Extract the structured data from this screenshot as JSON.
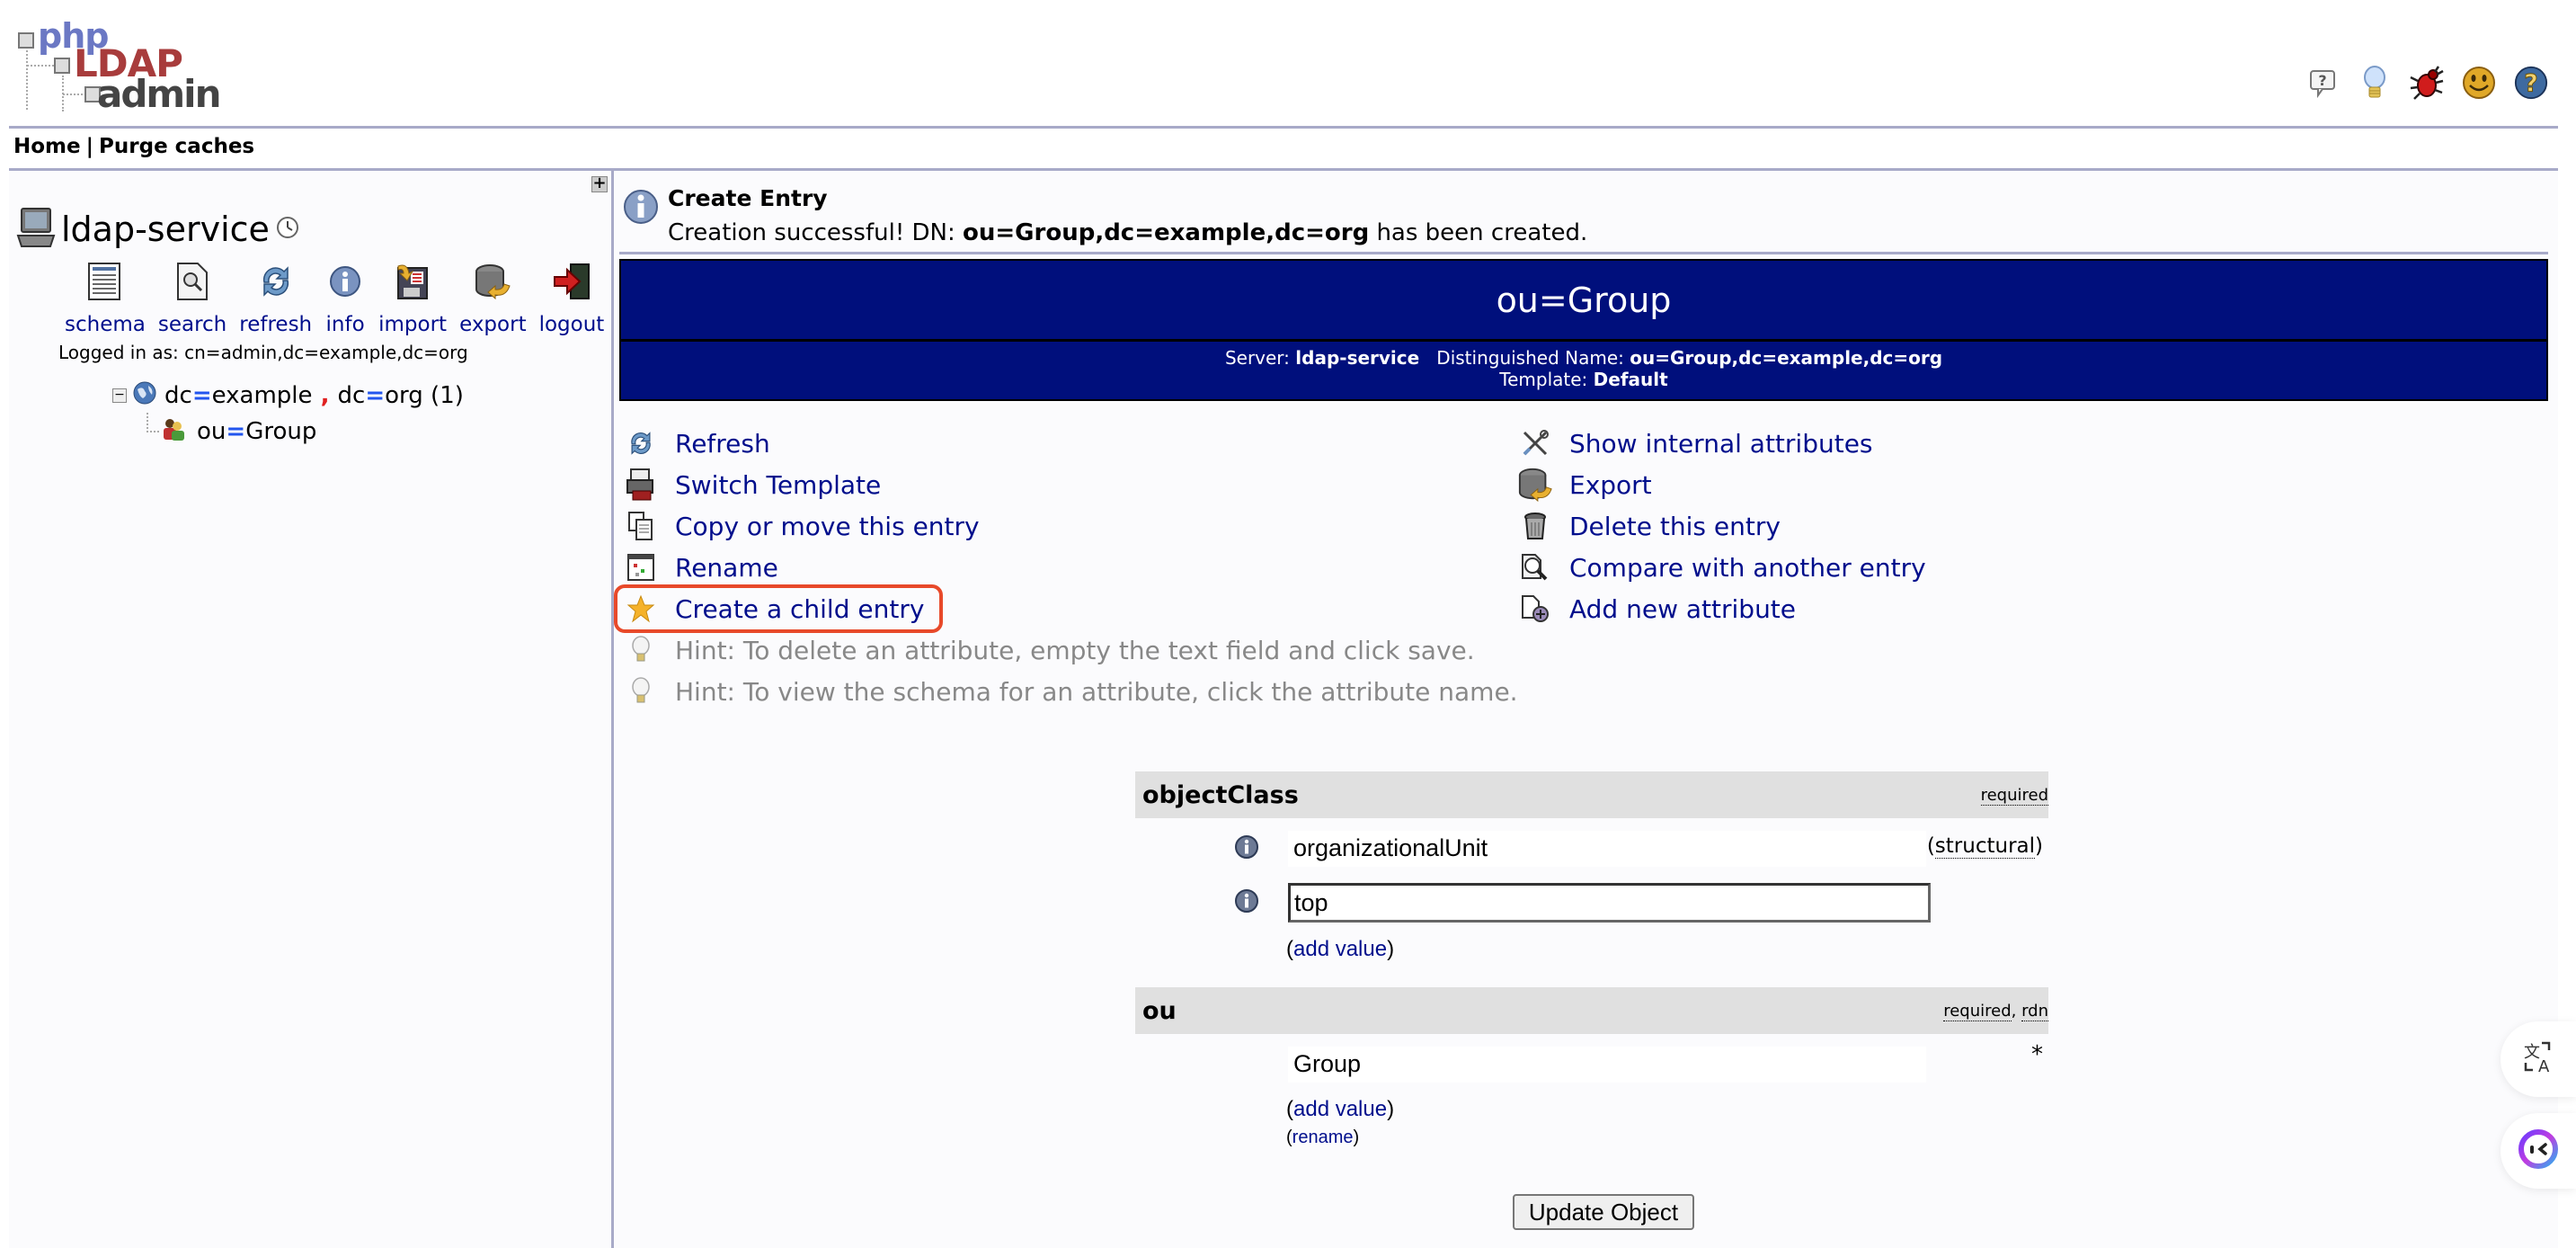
{
  "app": {
    "logo": {
      "php": "php",
      "ldap": "LDAP",
      "admin": "admin"
    },
    "top_icons": [
      {
        "name": "help-bubble-icon",
        "title": "Help"
      },
      {
        "name": "lightbulb-icon",
        "title": "Suggestion"
      },
      {
        "name": "bug-icon",
        "title": "Report a bug"
      },
      {
        "name": "smiley-icon",
        "title": "Donate"
      },
      {
        "name": "help-globe-icon",
        "title": "Help"
      }
    ],
    "colors": {
      "link": "#000e8c",
      "banner": "#000f7c",
      "divider": "#a8aac8",
      "highlight": "#e8492a"
    }
  },
  "nav": {
    "home": "Home",
    "separator": "|",
    "purge": "Purge caches"
  },
  "sidebar": {
    "expand_label": "+",
    "server_name": "ldap-service",
    "server_buttons": [
      {
        "label": "schema",
        "icon": "schema-icon"
      },
      {
        "label": "search",
        "icon": "search-icon"
      },
      {
        "label": "refresh",
        "icon": "refresh-icon"
      },
      {
        "label": "info",
        "icon": "info-icon"
      },
      {
        "label": "import",
        "icon": "import-icon"
      },
      {
        "label": "export",
        "icon": "export-icon"
      },
      {
        "label": "logout",
        "icon": "logout-icon"
      }
    ],
    "logged_in": "Logged in as: cn=admin,dc=example,dc=org",
    "tree": {
      "root": {
        "k1": "dc",
        "v1": "example",
        "k2": "dc",
        "v2": "org",
        "count": "(1)",
        "toggle": "−"
      },
      "child": {
        "k": "ou",
        "v": "Group"
      }
    }
  },
  "main": {
    "notice": {
      "title": "Create Entry",
      "prefix": "Creation successful! DN: ",
      "dn": "ou=Group,dc=example,dc=org",
      "suffix": " has been created."
    },
    "banner": {
      "title": "ou=Group",
      "server_label": "Server: ",
      "server": "ldap-service",
      "dn_label": "Distinguished Name: ",
      "dn": "ou=Group,dc=example,dc=org",
      "template_label": "Template: ",
      "template": "Default"
    },
    "actions_left": [
      {
        "label": "Refresh",
        "icon": "refresh-icon"
      },
      {
        "label": "Switch Template",
        "icon": "switch-template-icon"
      },
      {
        "label": "Copy or move this entry",
        "icon": "copy-icon"
      },
      {
        "label": "Rename",
        "icon": "rename-icon"
      },
      {
        "label": "Create a child entry",
        "icon": "star-icon",
        "highlighted": true
      }
    ],
    "hints": [
      "Hint: To delete an attribute, empty the text field and click save.",
      "Hint: To view the schema for an attribute, click the attribute name."
    ],
    "actions_right": [
      {
        "label": "Show internal attributes",
        "icon": "tools-icon"
      },
      {
        "label": "Export",
        "icon": "export-icon"
      },
      {
        "label": "Delete this entry",
        "icon": "trash-icon"
      },
      {
        "label": "Compare with another entry",
        "icon": "compare-icon"
      },
      {
        "label": "Add new attribute",
        "icon": "add-attribute-icon"
      }
    ],
    "attributes": {
      "objectClass": {
        "name": "objectClass",
        "flags": "required",
        "values": [
          "organizationalUnit",
          "top"
        ],
        "structural_tag": "structural",
        "add_value": "add value"
      },
      "ou": {
        "name": "ou",
        "flags_required": "required",
        "flags_rdn": "rdn",
        "value": "Group",
        "rdn_marker": "*",
        "add_value": "add value",
        "rename": "rename"
      }
    },
    "update_button": "Update Object"
  }
}
